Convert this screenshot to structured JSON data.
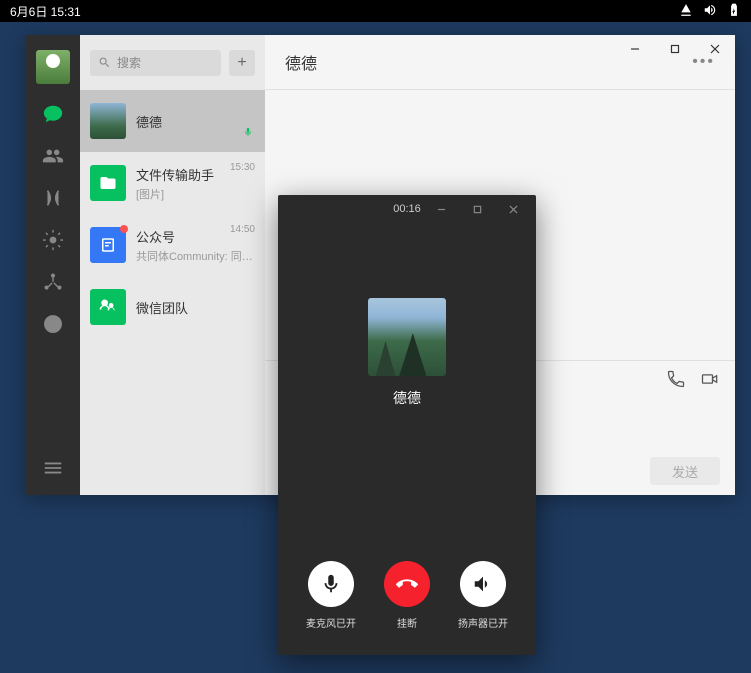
{
  "sysbar": {
    "datetime": "6月6日 15:31"
  },
  "search": {
    "placeholder": "搜索"
  },
  "conversations": {
    "0": {
      "name": "德德"
    },
    "1": {
      "name": "文件传输助手",
      "sub": "[图片]",
      "time": "15:30"
    },
    "2": {
      "name": "公众号",
      "sub": "共同体Community: 同欣…",
      "time": "14:50"
    },
    "3": {
      "name": "微信团队"
    }
  },
  "chat": {
    "title": "德德",
    "send": "发送"
  },
  "call": {
    "timer": "00:16",
    "name": "德德",
    "mic": "麦克风已开",
    "hangup": "挂断",
    "speaker": "扬声器已开"
  }
}
